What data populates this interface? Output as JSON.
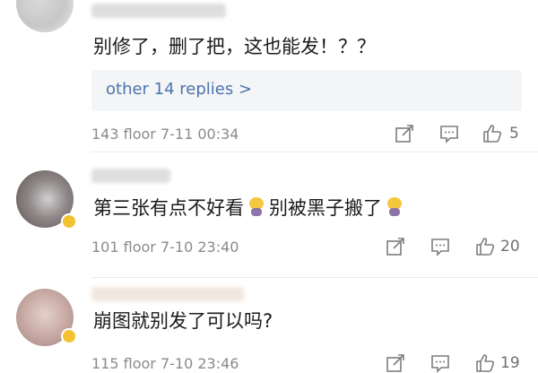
{
  "comments": [
    {
      "text": "别修了，删了把，这也能发！？？",
      "replies_link": "other 14 replies >",
      "floor": "143 floor",
      "time": "7-11 00:34",
      "likes": "5"
    },
    {
      "text_a": "第三张有点不好看",
      "text_b": "别被黑子搬了",
      "floor": "101 floor",
      "time": "7-10 23:40",
      "likes": "20"
    },
    {
      "text": "崩图就别发了可以吗?",
      "floor": "115 floor",
      "time": "7-10 23:46",
      "likes": "19"
    }
  ],
  "icons": [
    "share-icon",
    "comment-icon",
    "like-icon",
    "emoji-icon"
  ],
  "colors": {
    "link": "#4c74ad",
    "meta": "#8a8a8a",
    "reply_bg": "#f4f5f7"
  }
}
